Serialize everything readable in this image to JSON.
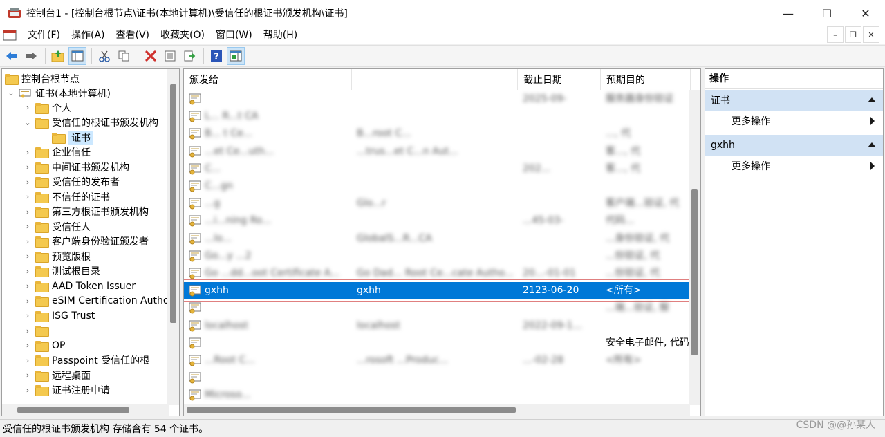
{
  "window": {
    "title": "控制台1 - [控制台根节点\\证书(本地计算机)\\受信任的根证书颁发机构\\证书]",
    "minimize": "—",
    "maximize": "☐",
    "close": "✕"
  },
  "menu": [
    "文件(F)",
    "操作(A)",
    "查看(V)",
    "收藏夹(O)",
    "窗口(W)",
    "帮助(H)"
  ],
  "mdi": {
    "minimize": "–",
    "restore": "❐",
    "close": "✕"
  },
  "toolbar_icons": [
    "back-icon",
    "forward-icon",
    "up-folder-icon",
    "show-hide-tree-icon",
    "cut-icon",
    "copy-icon",
    "delete-icon",
    "properties-icon",
    "export-icon",
    "help-icon",
    "show-action-pane-icon"
  ],
  "tree": {
    "root": "控制台根节点",
    "store": "证书(本地计算机)",
    "children": [
      {
        "label": "个人",
        "expanded": false
      },
      {
        "label": "受信任的根证书颁发机构",
        "expanded": true
      },
      {
        "label": "企业信任",
        "expanded": false
      },
      {
        "label": "中间证书颁发机构",
        "expanded": false
      },
      {
        "label": "受信任的发布者",
        "expanded": false
      },
      {
        "label": "不信任的证书",
        "expanded": false
      },
      {
        "label": "第三方根证书颁发机构",
        "expanded": false
      },
      {
        "label": "受信任人",
        "expanded": false
      },
      {
        "label": "客户端身份验证颁发者",
        "expanded": false
      },
      {
        "label": "预览版根",
        "expanded": false
      },
      {
        "label": "测试根目录",
        "expanded": false
      },
      {
        "label": "AAD Token Issuer",
        "expanded": false
      },
      {
        "label": "eSIM Certification Autho",
        "expanded": false
      },
      {
        "label": "ISG Trust",
        "expanded": false
      },
      {
        "label": "",
        "expanded": false
      },
      {
        "label": "OP",
        "expanded": false
      },
      {
        "label": "Passpoint 受信任的根",
        "expanded": false
      },
      {
        "label": "远程桌面",
        "expanded": false
      },
      {
        "label": "证书注册申请",
        "expanded": false
      }
    ],
    "selected_child": "证书"
  },
  "list": {
    "columns": [
      "颁发给",
      "",
      "截止日期",
      "预期目的"
    ],
    "rows": [
      {
        "issued_to": "",
        "issued_by": "",
        "expiry": "2025-09-",
        "purpose": "服务器身份验证",
        "blurred": true
      },
      {
        "issued_to": "L... R...t CA",
        "issued_by": "",
        "expiry": "",
        "purpose": "",
        "blurred": true
      },
      {
        "issued_to": "B... t Ce...",
        "issued_by": "B...root C...",
        "expiry": "",
        "purpose": "..., 代",
        "blurred": true
      },
      {
        "issued_to": "...et Ce...uth...",
        "issued_by": "...trus...et C...n Aut...",
        "expiry": "",
        "purpose": "客..., 代",
        "blurred": true
      },
      {
        "issued_to": "C...",
        "issued_by": "",
        "expiry": "202...",
        "purpose": "客..., 代",
        "blurred": true
      },
      {
        "issued_to": "C...gn",
        "issued_by": "",
        "expiry": "",
        "purpose": "",
        "blurred": true
      },
      {
        "issued_to": "...g",
        "issued_by": "Glo...r",
        "expiry": "",
        "purpose": "客户端...验证, 代",
        "blurred": true
      },
      {
        "issued_to": "...i...ning Ro...",
        "issued_by": "",
        "expiry": "...45-03-",
        "purpose": "代码...",
        "blurred": true
      },
      {
        "issued_to": "...lo...",
        "issued_by": "GlobalS...R...CA",
        "expiry": "",
        "purpose": "...身份验证, 代",
        "blurred": true
      },
      {
        "issued_to": "Go...y ...2",
        "issued_by": "",
        "expiry": "",
        "purpose": "...份验证, 代",
        "blurred": true
      },
      {
        "issued_to": "Go ...dd...oot Certificate A...",
        "issued_by": "Go Dad... Root Ce...cate Autho...",
        "expiry": "20...-01-01",
        "purpose": "...份验证, 代",
        "blurred": true
      },
      {
        "issued_to": "gxhh",
        "issued_by": "gxhh",
        "expiry": "2123-06-20",
        "purpose": "<所有>",
        "blurred": false,
        "selected": true
      },
      {
        "issued_to": "",
        "issued_by": "",
        "expiry": "",
        "purpose": "...端...验证, 服",
        "blurred": true
      },
      {
        "issued_to": "localhost",
        "issued_by": "localhost",
        "expiry": "2022-09-1...",
        "purpose": "",
        "blurred": true
      },
      {
        "issued_to": "",
        "issued_by": "",
        "expiry": "",
        "purpose": "安全电子邮件, 代码",
        "blurred": false
      },
      {
        "issued_to": "...Root C...",
        "issued_by": "...rosoft ...Produc...",
        "expiry": "...-02-28",
        "purpose": "<所有>",
        "blurred": true
      },
      {
        "issued_to": "",
        "issued_by": "",
        "expiry": "",
        "purpose": "",
        "blurred": true
      },
      {
        "issued_to": "Microso...",
        "issued_by": "",
        "expiry": "",
        "purpose": "",
        "blurred": true
      }
    ]
  },
  "actions": {
    "header": "操作",
    "groups": [
      {
        "title": "证书",
        "item": "更多操作"
      },
      {
        "title": "gxhh",
        "item": "更多操作"
      }
    ]
  },
  "status": "受信任的根证书颁发机构 存储含有 54 个证书。",
  "watermark": "CSDN @@孙某人"
}
